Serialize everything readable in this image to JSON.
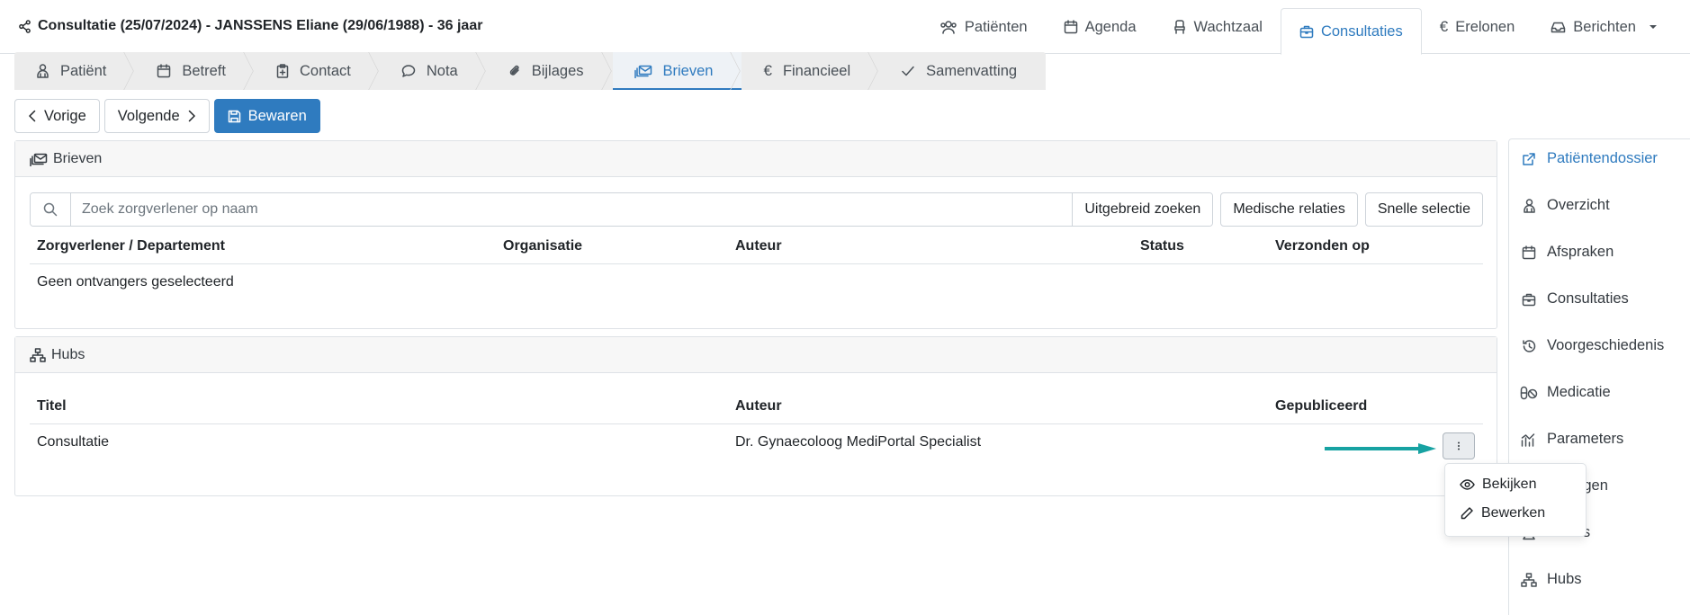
{
  "header": {
    "title": "Consultatie (25/07/2024) - JANSSENS Eliane (29/06/1988) - 36 jaar",
    "nav": [
      {
        "label": "Patiënten",
        "icon": "users-icon"
      },
      {
        "label": "Agenda",
        "icon": "calendar-icon"
      },
      {
        "label": "Wachtzaal",
        "icon": "chair-icon"
      },
      {
        "label": "Consultaties",
        "icon": "briefcase-icon",
        "active": true
      },
      {
        "label": "Erelonen",
        "icon": "euro-icon"
      },
      {
        "label": "Berichten",
        "icon": "inbox-icon"
      }
    ]
  },
  "steps": [
    {
      "label": "Patiënt",
      "icon": "person-icon"
    },
    {
      "label": "Betreft",
      "icon": "calendar-icon"
    },
    {
      "label": "Contact",
      "icon": "clipboard-plus-icon"
    },
    {
      "label": "Nota",
      "icon": "chat-icon"
    },
    {
      "label": "Bijlages",
      "icon": "paperclip-icon"
    },
    {
      "label": "Brieven",
      "icon": "envelopes-icon",
      "active": true
    },
    {
      "label": "Financieel",
      "icon": "euro-icon"
    },
    {
      "label": "Samenvatting",
      "icon": "check-icon"
    }
  ],
  "actions": {
    "prev": "Vorige",
    "next": "Volgende",
    "save": "Bewaren"
  },
  "brieven": {
    "title": "Brieven",
    "search_placeholder": "Zoek zorgverlener op naam",
    "buttons": {
      "advanced": "Uitgebreid zoeken",
      "relations": "Medische relaties",
      "quick": "Snelle selectie"
    },
    "columns": [
      "Zorgverlener / Departement",
      "Organisatie",
      "Auteur",
      "Status",
      "Verzonden op"
    ],
    "empty": "Geen ontvangers geselecteerd"
  },
  "hubs": {
    "title": "Hubs",
    "columns": [
      "Titel",
      "Auteur",
      "Gepubliceerd"
    ],
    "rows": [
      {
        "titel": "Consultatie",
        "auteur": "Dr. Gynaecoloog MediPortal Specialist",
        "gepubliceerd": ""
      }
    ],
    "menu": {
      "view": "Bekijken",
      "edit": "Bewerken"
    }
  },
  "sidebar": {
    "items": [
      {
        "label": "Patiëntendossier",
        "icon": "external-link-icon"
      },
      {
        "label": "Overzicht",
        "icon": "person-icon"
      },
      {
        "label": "Afspraken",
        "icon": "calendar-icon"
      },
      {
        "label": "Consultaties",
        "icon": "briefcase-icon"
      },
      {
        "label": "Voorgeschiedenis",
        "icon": "history-icon"
      },
      {
        "label": "Medicatie",
        "icon": "pills-icon"
      },
      {
        "label": "Parameters",
        "icon": "chart-icon"
      },
      {
        "label": "Metingen",
        "icon": "ruler-icon"
      },
      {
        "label": "Labo's",
        "icon": "flask-icon"
      },
      {
        "label": "Hubs",
        "icon": "network-icon"
      }
    ]
  },
  "colors": {
    "accent": "#2f7bbf",
    "arrow": "#17a2a2"
  }
}
